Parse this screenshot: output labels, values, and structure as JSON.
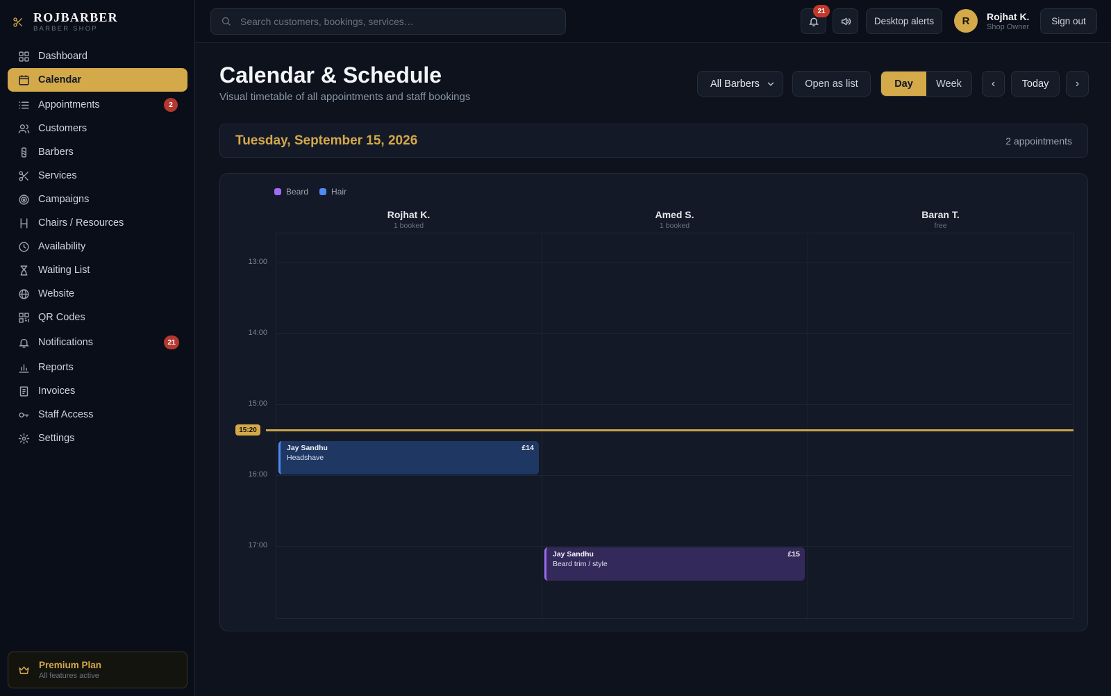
{
  "brand": {
    "title": "ROJBARBER",
    "subtitle": "BARBER SHOP"
  },
  "sidebar": {
    "items": [
      {
        "label": "Dashboard",
        "icon": "dashboard-icon"
      },
      {
        "label": "Calendar",
        "icon": "calendar-icon",
        "active": true
      },
      {
        "label": "Appointments",
        "icon": "list-icon",
        "badge": "2"
      },
      {
        "label": "Customers",
        "icon": "users-icon"
      },
      {
        "label": "Barbers",
        "icon": "barber-pole-icon"
      },
      {
        "label": "Services",
        "icon": "scissors-icon"
      },
      {
        "label": "Campaigns",
        "icon": "target-icon"
      },
      {
        "label": "Chairs / Resources",
        "icon": "chair-icon"
      },
      {
        "label": "Availability",
        "icon": "clock-icon"
      },
      {
        "label": "Waiting List",
        "icon": "hourglass-icon"
      },
      {
        "label": "Website",
        "icon": "globe-icon"
      },
      {
        "label": "QR Codes",
        "icon": "qr-code-icon"
      },
      {
        "label": "Notifications",
        "icon": "bell-icon",
        "badge": "21"
      },
      {
        "label": "Reports",
        "icon": "bar-chart-icon"
      },
      {
        "label": "Invoices",
        "icon": "invoice-icon"
      },
      {
        "label": "Staff Access",
        "icon": "key-icon"
      },
      {
        "label": "Settings",
        "icon": "gear-icon"
      }
    ],
    "plan": {
      "title": "Premium Plan",
      "subtitle": "All features active"
    }
  },
  "topbar": {
    "search_placeholder": "Search customers, bookings, services…",
    "notification_count": "21",
    "desktop_alerts_label": "Desktop alerts",
    "user": {
      "initial": "R",
      "name": "Rojhat K.",
      "role": "Shop Owner"
    },
    "sign_out_label": "Sign out"
  },
  "page": {
    "title": "Calendar & Schedule",
    "subtitle": "Visual timetable of all appointments and staff bookings"
  },
  "controls": {
    "barber_filter": "All Barbers",
    "open_list_label": "Open as list",
    "view_day": "Day",
    "view_week": "Week",
    "active_view": "Day",
    "prev": "‹",
    "today": "Today",
    "next": "›"
  },
  "date_bar": {
    "date": "Tuesday, September 15, 2026",
    "count": "2 appointments"
  },
  "calendar": {
    "legend": [
      {
        "label": "Beard",
        "color": "#a36bf5"
      },
      {
        "label": "Hair",
        "color": "#4f8af5"
      }
    ],
    "columns": [
      {
        "name": "Rojhat K.",
        "status": "1 booked"
      },
      {
        "name": "Amed S.",
        "status": "1 booked"
      },
      {
        "name": "Baran T.",
        "status": "free"
      }
    ],
    "hours": [
      "13:00",
      "14:00",
      "15:00",
      "16:00",
      "17:00"
    ],
    "now": "15:20",
    "appointments": [
      {
        "customer": "Jay Sandhu",
        "service": "Headshave",
        "price": "£14",
        "category": "hair",
        "barber": "Rojhat K.",
        "start": "15:30",
        "end": "16:00"
      },
      {
        "customer": "Jay Sandhu",
        "service": "Beard trim / style",
        "price": "£15",
        "category": "beard",
        "barber": "Amed S.",
        "start": "17:00",
        "end": "17:30"
      }
    ]
  },
  "colors": {
    "accent": "#d4a94a",
    "badge": "#b3382f",
    "hair": "#4f8af5",
    "beard": "#9b6bf0"
  }
}
